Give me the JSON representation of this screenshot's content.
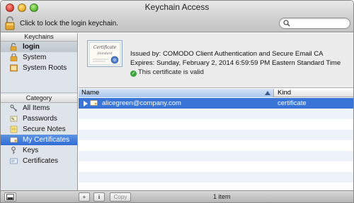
{
  "window": {
    "title": "Keychain Access"
  },
  "toolbar": {
    "lock_text": "Click to lock the login keychain.",
    "search_placeholder": ""
  },
  "sidebar": {
    "keychains_header": "Keychains",
    "keychains": [
      {
        "label": "login",
        "icon": "keychain-open-icon"
      },
      {
        "label": "System",
        "icon": "keychain-icon"
      },
      {
        "label": "System Roots",
        "icon": "keychain-icon"
      }
    ],
    "category_header": "Category",
    "categories": [
      {
        "label": "All Items",
        "icon": "all-items-icon"
      },
      {
        "label": "Passwords",
        "icon": "passwords-icon"
      },
      {
        "label": "Secure Notes",
        "icon": "secure-notes-icon"
      },
      {
        "label": "My Certificates",
        "icon": "my-certificates-icon"
      },
      {
        "label": "Keys",
        "icon": "keys-icon"
      },
      {
        "label": "Certificates",
        "icon": "certificates-icon"
      }
    ]
  },
  "detail": {
    "certificate_graphic_title": "Certificate",
    "certificate_graphic_subtitle": "Standard",
    "issued": "Issued by: COMODO Client Authentication and Secure Email CA",
    "expires": "Expires: Sunday, February 2, 2014 6:59:59 PM Eastern Standard Time",
    "valid": "This certificate is valid"
  },
  "table": {
    "columns": {
      "name": "Name",
      "kind": "Kind"
    },
    "rows": [
      {
        "name": "alicegreen@company.com",
        "kind": "certificate"
      }
    ]
  },
  "bottombar": {
    "add_label": "+",
    "info_label": "i",
    "copy_label": "Copy",
    "count": "1 item"
  },
  "colors": {
    "selection_blue": "#3875d7",
    "sidebar_bg": "#dfe4ea"
  }
}
